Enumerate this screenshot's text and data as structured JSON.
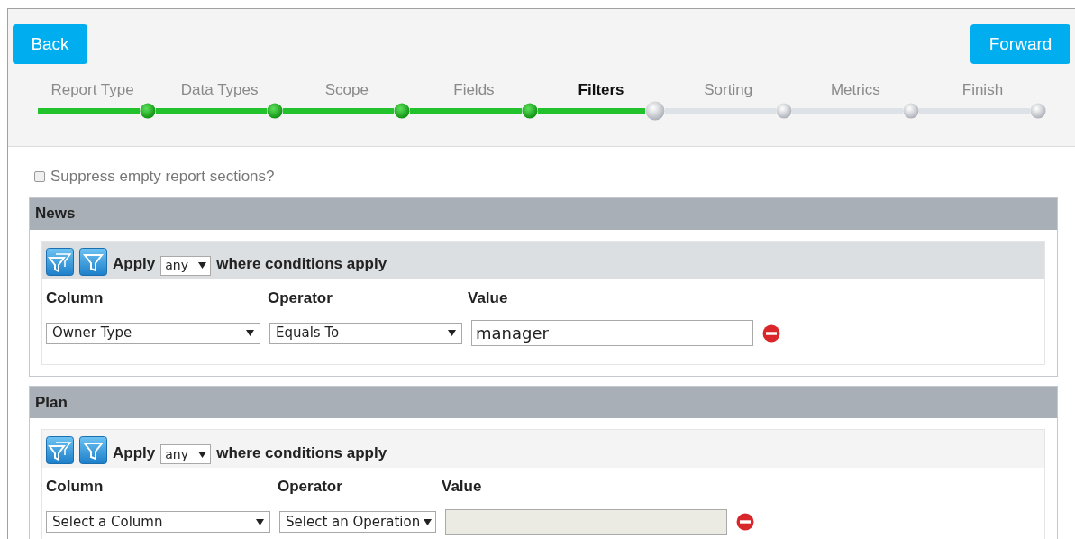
{
  "nav": {
    "back": "Back",
    "forward": "Forward"
  },
  "steps": [
    {
      "label": "Report Type",
      "completed": true,
      "selected": false
    },
    {
      "label": "Data Types",
      "completed": true,
      "selected": false
    },
    {
      "label": "Scope",
      "completed": true,
      "selected": false
    },
    {
      "label": "Fields",
      "completed": true,
      "selected": false
    },
    {
      "label": "Filters",
      "completed": false,
      "selected": true
    },
    {
      "label": "Sorting",
      "completed": false,
      "selected": false
    },
    {
      "label": "Metrics",
      "completed": false,
      "selected": false
    },
    {
      "label": "Finish",
      "completed": false,
      "selected": false
    }
  ],
  "suppress": {
    "label": "Suppress empty report sections?",
    "checked": false
  },
  "sections": [
    {
      "title": "News",
      "highlighted": true,
      "apply_label": "Apply",
      "apply_mode": "any",
      "apply_suffix": "where conditions apply",
      "headers": [
        "Column",
        "Operator",
        "Value"
      ],
      "condition": {
        "column": "Owner Type",
        "operator": "Equals To",
        "value": "manager",
        "disabled": false
      }
    },
    {
      "title": "Plan",
      "highlighted": false,
      "apply_label": "Apply",
      "apply_mode": "any",
      "apply_suffix": "where conditions apply",
      "headers": [
        "Column",
        "Operator",
        "Value"
      ],
      "condition": {
        "column": "Select a Column",
        "operator": "Select an Operation",
        "disabled": true
      }
    }
  ]
}
